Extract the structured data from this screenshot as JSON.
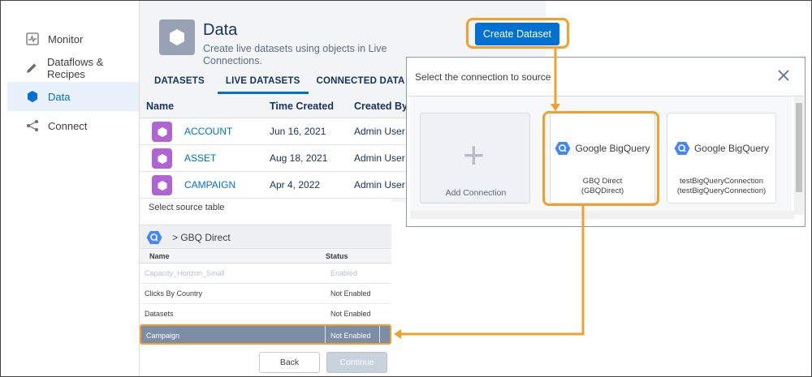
{
  "sidebar": {
    "items": [
      {
        "label": "Monitor",
        "icon": "monitor-icon"
      },
      {
        "label": "Dataflows & Recipes",
        "icon": "pencil-icon"
      },
      {
        "label": "Data",
        "icon": "hexagon-icon",
        "active": true
      },
      {
        "label": "Connect",
        "icon": "share-icon"
      }
    ]
  },
  "header": {
    "title": "Data",
    "description": "Create live datasets using objects in Live Connections.",
    "create_button": "Create Dataset"
  },
  "tabs": [
    {
      "label": "DATASETS"
    },
    {
      "label": "LIVE DATASETS",
      "active": true
    },
    {
      "label": "CONNECTED DATA"
    }
  ],
  "table": {
    "columns": [
      "Name",
      "Time Created",
      "Created By"
    ],
    "rows": [
      {
        "name": "ACCOUNT",
        "time": "Jun 16, 2021",
        "by": "Admin User"
      },
      {
        "name": "ASSET",
        "time": "Aug 18, 2021",
        "by": "Admin User"
      },
      {
        "name": "CAMPAIGN",
        "time": "Apr 4, 2022",
        "by": "Admin User"
      }
    ]
  },
  "source_panel": {
    "title": "Select source table",
    "crumb": "> GBQ Direct",
    "columns": [
      "Name",
      "Status"
    ],
    "rows": [
      {
        "name": "Capacity_Horizon_Small",
        "status": "Enabled",
        "state": "disabled"
      },
      {
        "name": "Clicks By  Country",
        "status": "Not Enabled",
        "state": "normal"
      },
      {
        "name": "Datasets",
        "status": "Not Enabled",
        "state": "normal"
      },
      {
        "name": "Campaign",
        "status": "Not Enabled",
        "state": "selected"
      }
    ],
    "back_label": "Back",
    "continue_label": "Continue"
  },
  "modal": {
    "title": "Select the connection to source",
    "add_label": "Add Connection",
    "brand": "Google BigQuery",
    "cards": [
      {
        "line1": "GBQ Direct",
        "line2": "(GBQDirect)"
      },
      {
        "line1": "testBigQueryConnection",
        "line2": "(testBigQueryConnection)"
      }
    ]
  },
  "colors": {
    "accent": "#0070d2",
    "highlight": "#f0a030",
    "dataset_icon": "#b064d4"
  }
}
